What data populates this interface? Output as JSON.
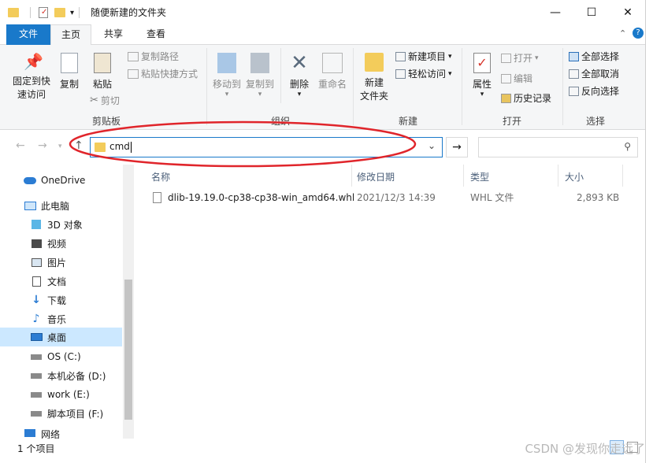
{
  "window": {
    "title": "随便新建的文件夹",
    "controls": [
      "—",
      "☐",
      "✕"
    ]
  },
  "tabs": [
    {
      "label": "文件"
    },
    {
      "label": "主页"
    },
    {
      "label": "共享"
    },
    {
      "label": "查看"
    }
  ],
  "ribbon": {
    "clipboard": {
      "pin_label_1": "固定到快",
      "pin_label_2": "速访问",
      "copy_label": "复制",
      "paste_label": "粘贴",
      "copy_path": "复制路径",
      "paste_shortcut": "粘贴快捷方式",
      "cut": "剪切",
      "group": "剪贴板"
    },
    "organize": {
      "move_to": "移动到",
      "copy_to": "复制到",
      "delete": "删除",
      "rename": "重命名",
      "group": "组织"
    },
    "new": {
      "new_folder_1": "新建",
      "new_folder_2": "文件夹",
      "new_item": "新建项目",
      "easy_access": "轻松访问",
      "group": "新建"
    },
    "open": {
      "properties": "属性",
      "open": "打开",
      "edit": "编辑",
      "history": "历史记录",
      "group": "打开"
    },
    "select": {
      "select_all": "全部选择",
      "select_none": "全部取消",
      "invert": "反向选择",
      "group": "选择"
    }
  },
  "address": {
    "value": "cmd"
  },
  "nav": {
    "items": [
      {
        "label": "OneDrive",
        "icon": "cloud-icon"
      },
      {
        "label": "此电脑",
        "icon": "pc-icon"
      },
      {
        "label": "3D 对象",
        "icon": "cube-icon"
      },
      {
        "label": "视频",
        "icon": "video-icon"
      },
      {
        "label": "图片",
        "icon": "picture-icon"
      },
      {
        "label": "文档",
        "icon": "document-icon"
      },
      {
        "label": "下载",
        "icon": "download-icon"
      },
      {
        "label": "音乐",
        "icon": "music-icon"
      },
      {
        "label": "桌面",
        "icon": "desktop-icon"
      },
      {
        "label": "OS (C:)",
        "icon": "drive-icon"
      },
      {
        "label": "本机必备 (D:)",
        "icon": "drive-icon"
      },
      {
        "label": "work (E:)",
        "icon": "drive-icon"
      },
      {
        "label": "脚本项目 (F:)",
        "icon": "drive-icon"
      },
      {
        "label": "网络",
        "icon": "network-icon"
      }
    ]
  },
  "list": {
    "headers": {
      "name": "名称",
      "date": "修改日期",
      "type": "类型",
      "size": "大小"
    },
    "rows": [
      {
        "name": "dlib-19.19.0-cp38-cp38-win_amd64.whl",
        "date": "2021/12/3 14:39",
        "type": "WHL 文件",
        "size": "2,893 KB"
      }
    ]
  },
  "status": {
    "count": "1 个项目"
  },
  "watermark": "CSDN @发现你走远了",
  "colors": {
    "accent": "#1979ca",
    "selection": "#cce8ff",
    "annotation": "#e0252b"
  }
}
